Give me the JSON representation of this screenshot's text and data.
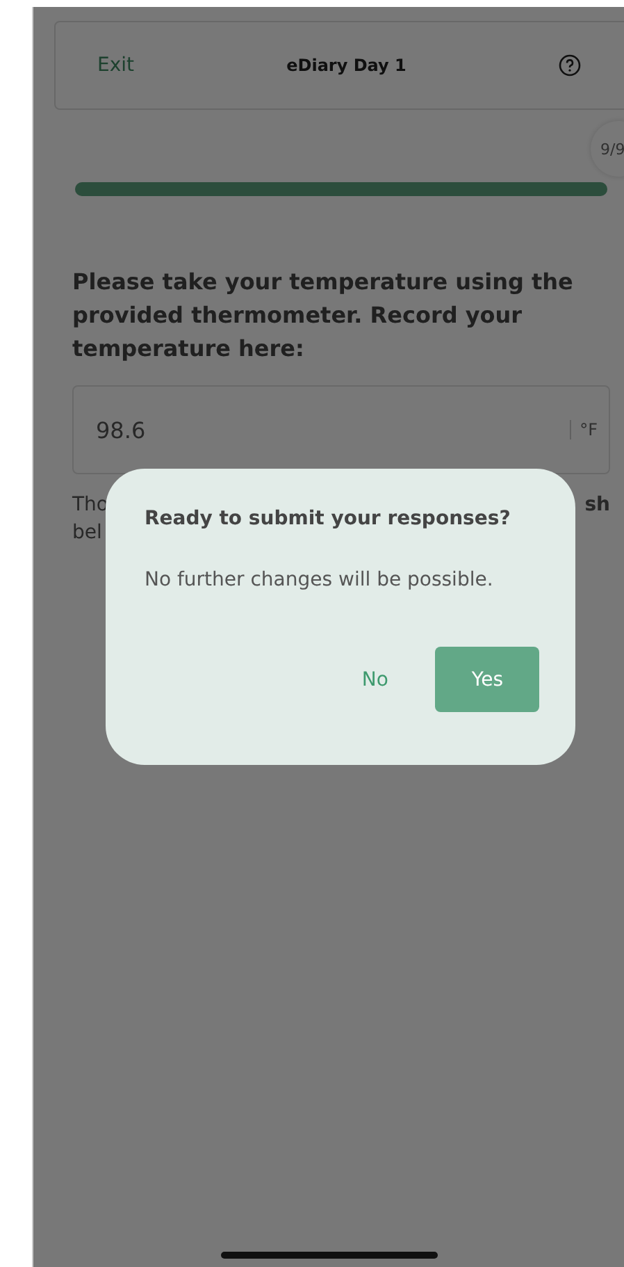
{
  "header": {
    "exit": "Exit",
    "title": "eDiary Day 1"
  },
  "progress": {
    "badge": "9/9",
    "level": 1
  },
  "question": {
    "text": "Please take your temperature using the provided thermometer. Record your temperature here:",
    "value": "98.6",
    "unit": "°F"
  },
  "note_fragments": {
    "line_1_start": "Tho",
    "line_1_end": "sh",
    "line_2_start": "bel"
  },
  "dialog": {
    "title": "Ready to submit your responses?",
    "message": "No further changes will be possible.",
    "buttons": [
      {
        "label": "No",
        "kind": "text"
      },
      {
        "label": "Yes",
        "kind": "primary"
      }
    ]
  }
}
